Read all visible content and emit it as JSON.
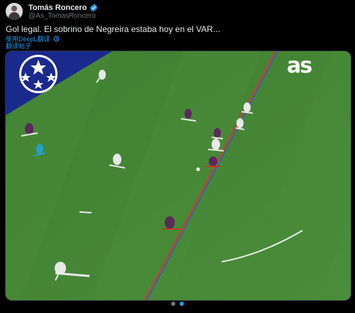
{
  "author": {
    "name": "Tomás Roncero",
    "handle": "@As_TomasRoncero"
  },
  "tweet": {
    "text": "Gol legal. El sobrino de Negreira estaba hoy en el VAR...",
    "translate_with": "使用DeepL翻译",
    "translate_post": "翻译帖子"
  },
  "media": {
    "brand_logo": "as",
    "carousel_pages": 2,
    "carousel_active": 2
  },
  "colors": {
    "accent": "#1d9bf0",
    "pitch_light": "#4a8b3a",
    "pitch_dark": "#3e7a30",
    "offside_line_red": "#d13a2f",
    "offside_line_blue": "#2a5bd7",
    "ucl_blue": "#1a2a8c"
  }
}
